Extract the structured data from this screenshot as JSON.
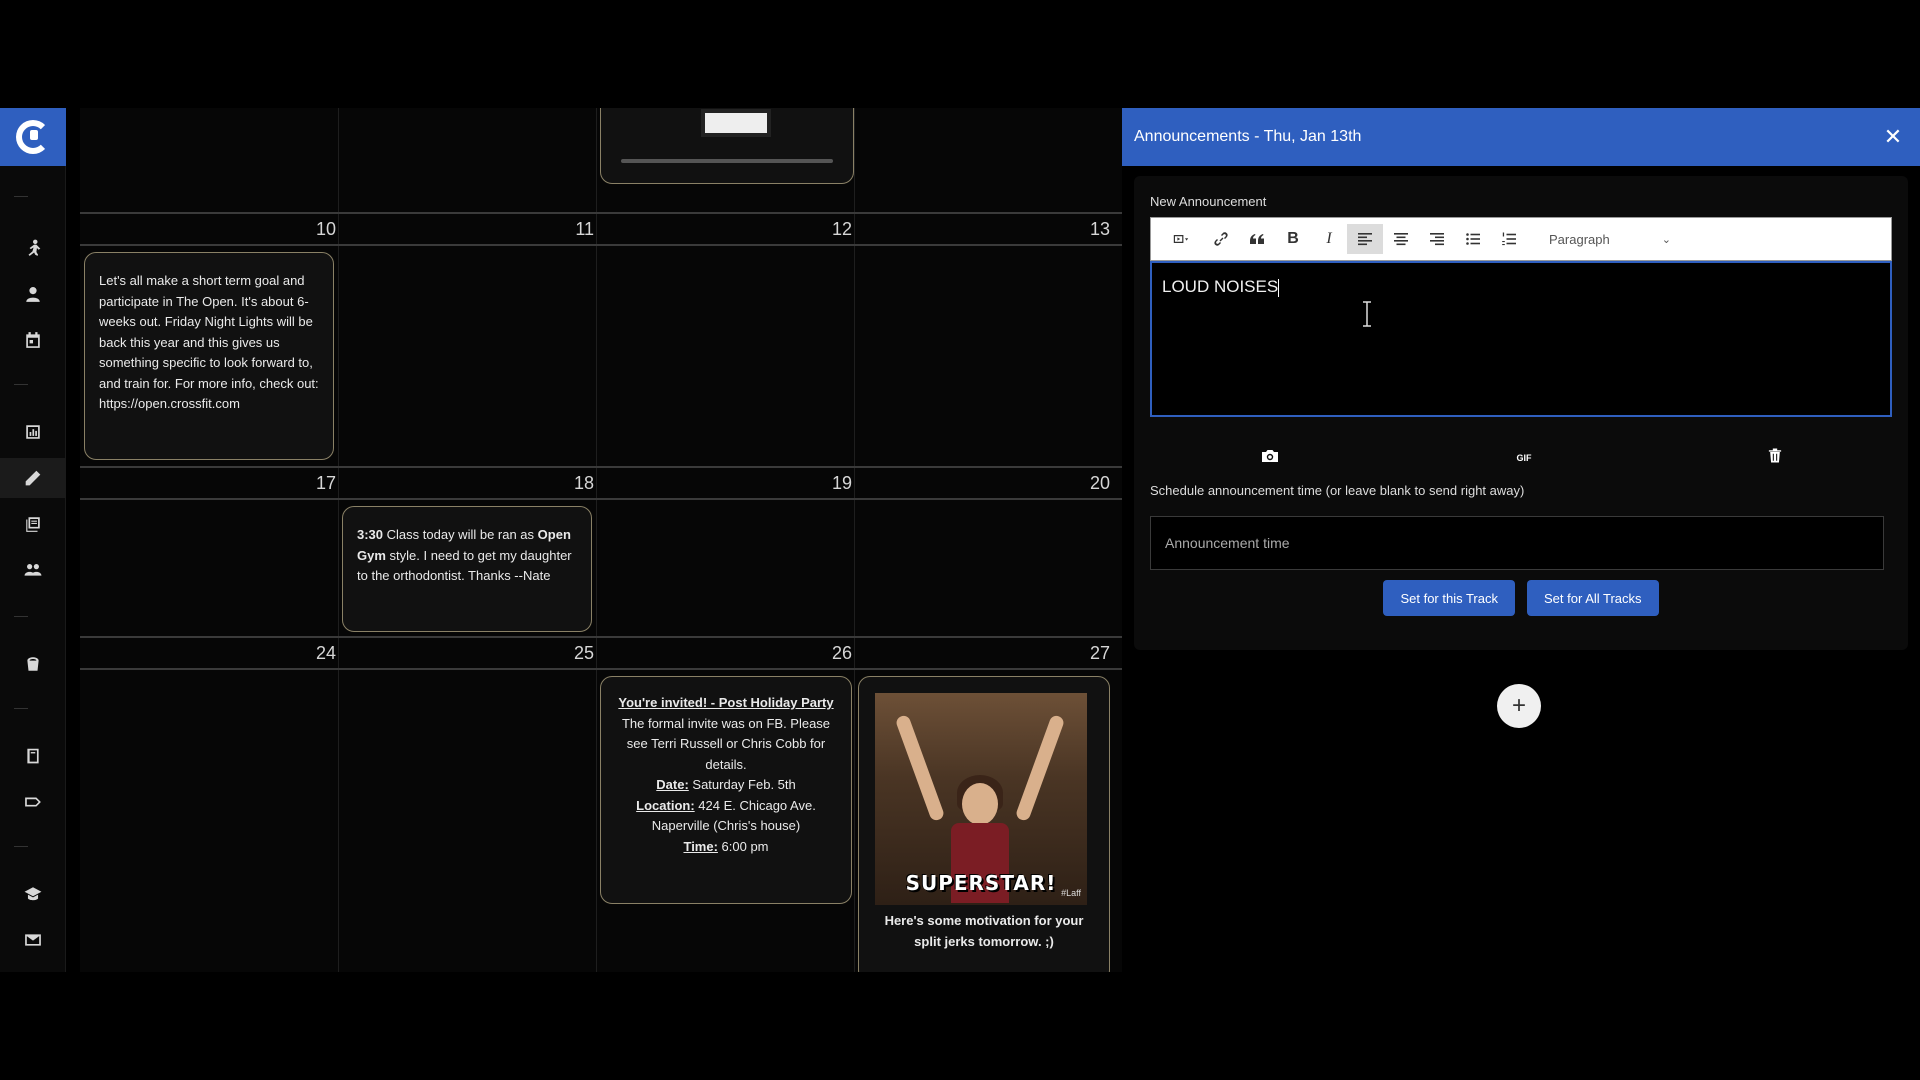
{
  "sidebar": {
    "logo_icon": "gym-logo-icon",
    "items": [
      {
        "icon": "runner-icon"
      },
      {
        "icon": "user-icon"
      },
      {
        "icon": "calendar-icon"
      },
      {
        "icon": "chart-icon"
      },
      {
        "icon": "pencil-icon",
        "active": true
      },
      {
        "icon": "stack-icon"
      },
      {
        "icon": "group-icon"
      },
      {
        "icon": "bucket-icon"
      },
      {
        "icon": "book-icon"
      },
      {
        "icon": "tag-icon"
      },
      {
        "icon": "graduation-cap-icon"
      },
      {
        "icon": "mail-icon"
      }
    ]
  },
  "calendar": {
    "weeks": [
      {
        "days": [
          "10",
          "11",
          "12",
          "13"
        ]
      },
      {
        "days": [
          "17",
          "18",
          "19",
          "20"
        ]
      },
      {
        "days": [
          "24",
          "25",
          "26",
          "27"
        ]
      }
    ],
    "card_10": {
      "text": "Let's all make a short term goal and participate in The Open. It's about 6-weeks out. Friday Night Lights will be back this year and this gives us something specific to look forward to, and train for. For more info, check out: https://open.crossfit.com"
    },
    "card_18": {
      "time": "3:30",
      "text_a": " Class today will be ran as ",
      "bold": "Open Gym",
      "text_b": " style. I need to get my daughter to the orthodontist. Thanks --Nate"
    },
    "card_26": {
      "title": "You're invited! - Post Holiday Party",
      "body": "The formal invite was on FB. Please see Terri Russell or Chris Cobb for details.",
      "date_label": "Date:",
      "date_value": " Saturday Feb. 5th",
      "location_label": "Location:",
      "location_value": " 424 E. Chicago Ave. Naperville (Chris's house)",
      "time_label": "Time:",
      "time_value": " 6:00 pm"
    },
    "card_27": {
      "gif_caption": "SUPERSTAR!",
      "gif_tag": "#Laff",
      "text": "Here's some motivation for your split jerks tomorrow. ;)"
    }
  },
  "panel": {
    "title": "Announcements - Thu, Jan 13th",
    "new_label": "New Announcement",
    "toolbar": {
      "format_value": "Paragraph"
    },
    "editor_text": "LOUD NOISES",
    "gif_label": "GIF",
    "schedule_label": "Schedule announcement time (or leave blank to send right away)",
    "time_placeholder": "Announcement time",
    "btn_track": "Set for this Track",
    "btn_all": "Set for All Tracks",
    "add_label": "+"
  }
}
